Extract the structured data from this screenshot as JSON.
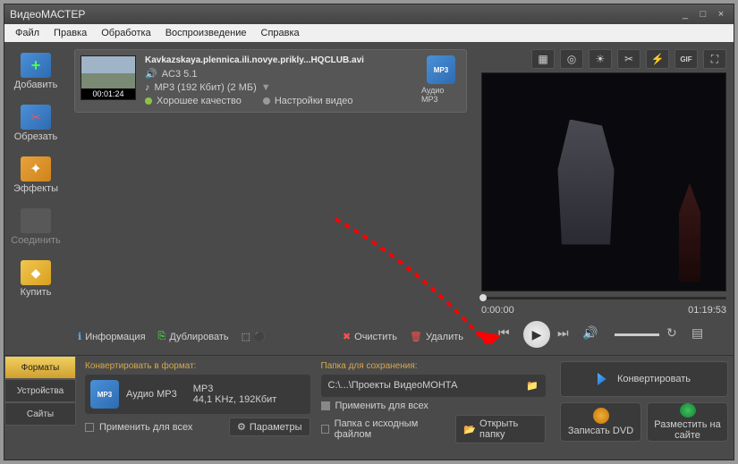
{
  "app_title": "ВидеоМАСТЕР",
  "menu": {
    "file": "Файл",
    "edit": "Правка",
    "processing": "Обработка",
    "playback": "Воспроизведение",
    "help": "Справка"
  },
  "sidebar": {
    "add": "Добавить",
    "cut": "Обрезать",
    "fx": "Эффекты",
    "join": "Соединить",
    "buy": "Купить"
  },
  "file": {
    "name": "Kavkazskaya.plennica.ili.novye.prikly...HQCLUB.avi",
    "audio": "AC3 5.1",
    "format": "MP3 (192 Кбит) (2 МБ)",
    "quality": "Хорошее качество",
    "settings": "Настройки видео",
    "duration": "00:01:24",
    "badge": "Аудио MP3",
    "badge_ico": "MP3"
  },
  "filetools": {
    "info": "Информация",
    "dup": "Дублировать",
    "clear": "Очистить",
    "del": "Удалить"
  },
  "preview": {
    "cur": "0:00:00",
    "total": "01:19:53"
  },
  "tabs": {
    "formats": "Форматы",
    "devices": "Устройства",
    "sites": "Сайты"
  },
  "convert_panel": {
    "title": "Конвертировать в формат:",
    "fmt_name": "Аудио MP3",
    "fmt_detail_1": "MP3",
    "fmt_detail_2": "44,1 KHz, 192Кбит",
    "fmt_ico": "MP3",
    "apply_all": "Применить для всех",
    "params": "Параметры"
  },
  "save_panel": {
    "title": "Папка для сохранения:",
    "path": "C:\\...\\Проекты ВидеоМОНТА",
    "apply_all": "Применить для всех",
    "src_folder": "Папка с исходным файлом",
    "open": "Открыть папку"
  },
  "actions": {
    "convert": "Конвертировать",
    "dvd": "Записать DVD",
    "web": "Разместить на сайте"
  }
}
